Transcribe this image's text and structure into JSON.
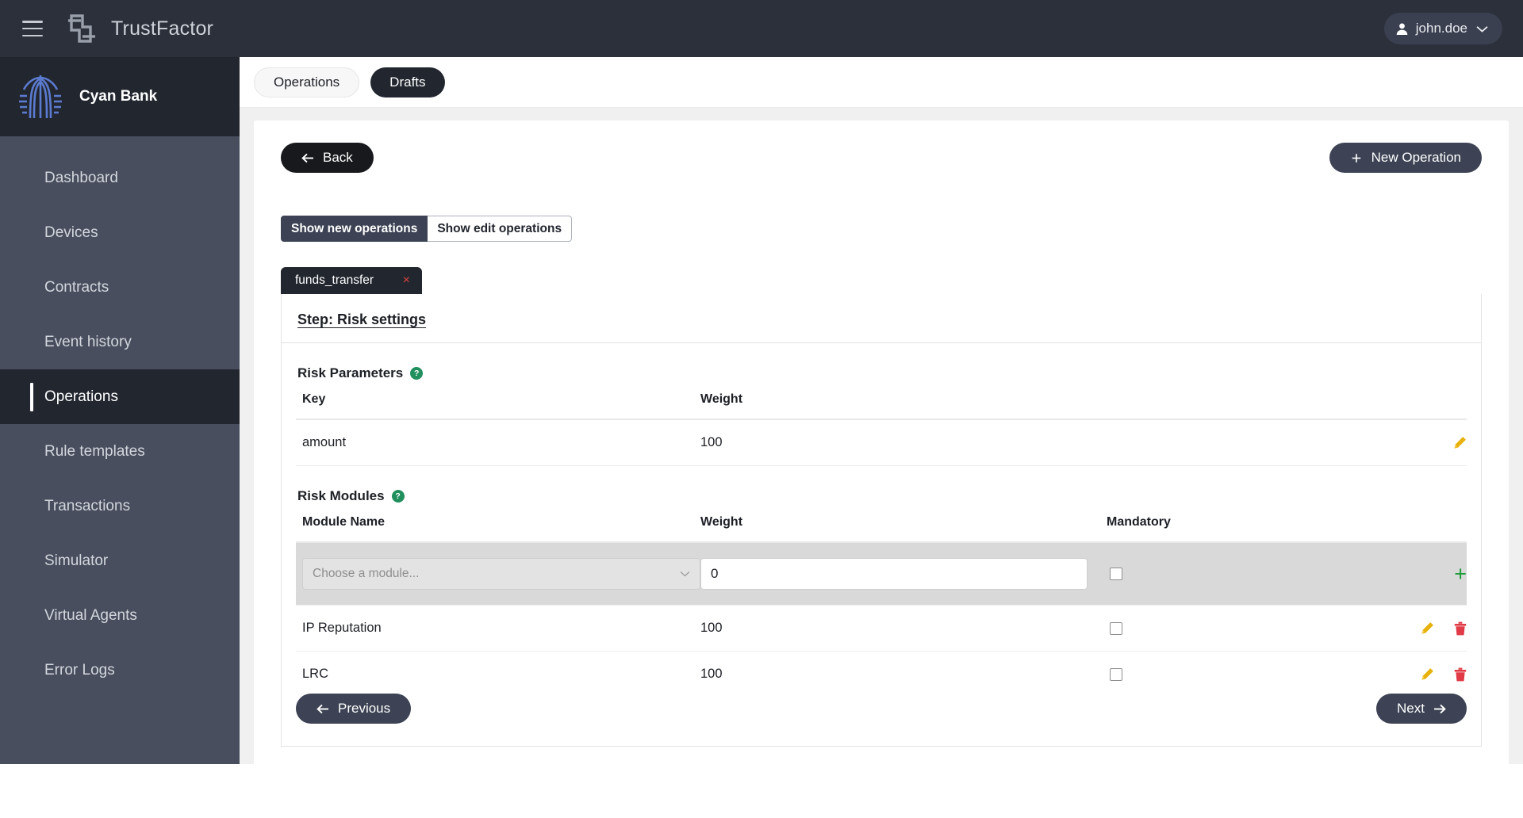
{
  "topbar": {
    "menu_icon": "hamburger-icon",
    "logo_icon": "trustfactor-logo",
    "app_name": "TrustFactor",
    "user": {
      "avatar_icon": "user-avatar-icon",
      "name": "john.doe",
      "chevron_icon": "chevron-down-icon"
    }
  },
  "sidebar": {
    "org_logo_icon": "cyan-bank-logo",
    "org_name": "Cyan Bank",
    "items": [
      {
        "label": "Dashboard",
        "active": false
      },
      {
        "label": "Devices",
        "active": false
      },
      {
        "label": "Contracts",
        "active": false
      },
      {
        "label": "Event history",
        "active": false
      },
      {
        "label": "Operations",
        "active": true
      },
      {
        "label": "Rule templates",
        "active": false
      },
      {
        "label": "Transactions",
        "active": false
      },
      {
        "label": "Simulator",
        "active": false
      },
      {
        "label": "Virtual Agents",
        "active": false
      },
      {
        "label": "Error Logs",
        "active": false
      }
    ]
  },
  "tabs": [
    {
      "label": "Operations",
      "selected": false
    },
    {
      "label": "Drafts",
      "selected": true
    }
  ],
  "toolbar": {
    "back_label": "Back",
    "back_icon": "arrow-left-icon",
    "new_operation_label": "New Operation",
    "new_operation_icon": "plus-icon"
  },
  "filters": {
    "show_new_label": "Show new operations",
    "show_edit_label": "Show edit operations",
    "active": "Show new operations"
  },
  "operation_tab": {
    "label": "funds_transfer",
    "close_icon": "close-icon",
    "close_glyph": "×"
  },
  "step": {
    "title": "Step: Risk settings"
  },
  "risk_parameters": {
    "section_title": "Risk Parameters",
    "help_icon": "help-circle-icon",
    "help_glyph": "?",
    "columns": [
      "Key",
      "Weight"
    ],
    "rows": [
      {
        "key": "amount",
        "weight": "100",
        "edit_icon": "pencil-icon"
      }
    ]
  },
  "risk_modules": {
    "section_title": "Risk Modules",
    "help_icon": "help-circle-icon",
    "help_glyph": "?",
    "columns": [
      "Module Name",
      "Weight",
      "Mandatory"
    ],
    "add_row": {
      "module_placeholder": "Choose a module...",
      "weight_value": "0",
      "mandatory_checked": false,
      "add_icon": "plus-icon",
      "add_glyph": "+"
    },
    "rows": [
      {
        "name": "IP Reputation",
        "weight": "100",
        "mandatory": false,
        "edit_icon": "pencil-icon",
        "delete_icon": "trash-icon"
      },
      {
        "name": "LRC",
        "weight": "100",
        "mandatory": false,
        "edit_icon": "pencil-icon",
        "delete_icon": "trash-icon"
      }
    ]
  },
  "wizard": {
    "previous_label": "Previous",
    "previous_icon": "arrow-left-icon",
    "next_label": "Next",
    "next_icon": "arrow-right-icon"
  },
  "colors": {
    "topbar_bg": "#2b303b",
    "sidebar_bg": "#484e5e",
    "sidebar_active_bg": "#22262f",
    "accent_dark": "#3d4354",
    "help_green": "#22905e",
    "add_green": "#1f9c3a",
    "edit_yellow": "#e8b10c",
    "delete_red": "#e03b46",
    "close_red": "#e0453e",
    "org_logo_blue": "#5b7bd0"
  }
}
